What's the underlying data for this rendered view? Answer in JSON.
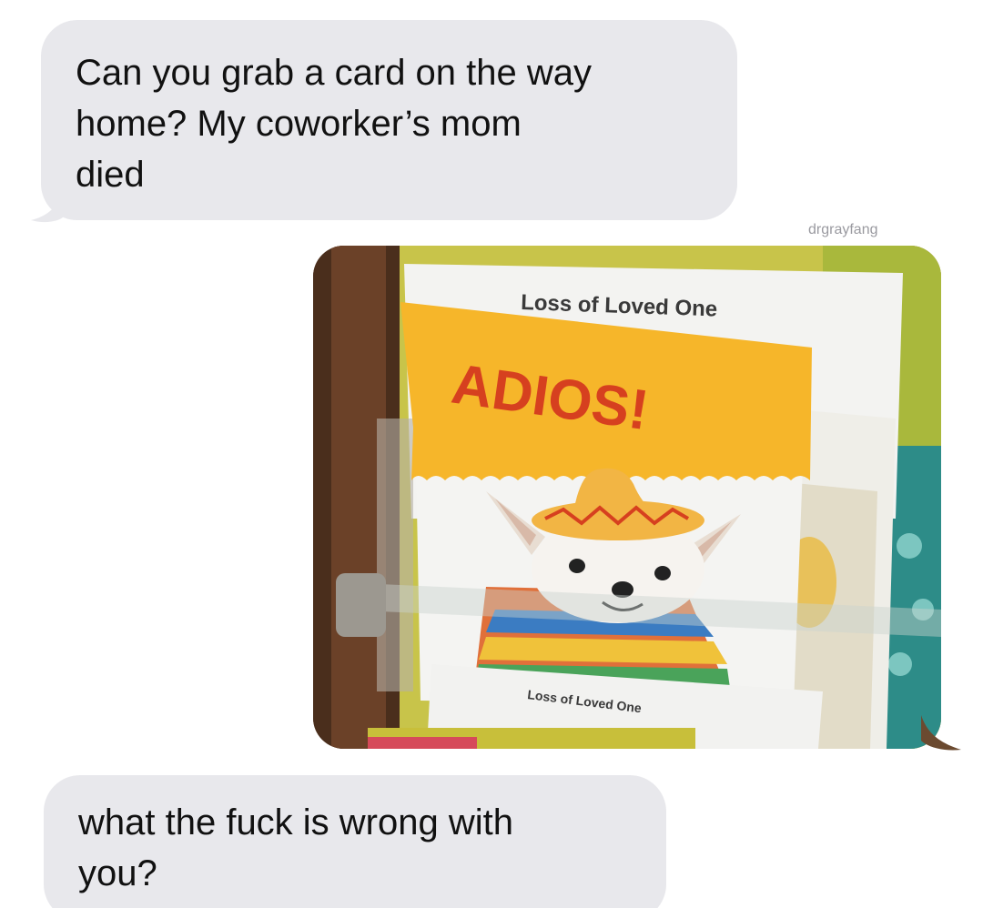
{
  "conversation": {
    "messages": [
      {
        "direction": "incoming",
        "text": "Can you grab a card on the way\nhome? My coworker’s mom\ndied"
      },
      {
        "direction": "outgoing",
        "type": "photo"
      },
      {
        "direction": "incoming",
        "text": "what the fuck is wrong with\nyou?"
      }
    ],
    "watermark": "drgrayfang"
  },
  "photo": {
    "back_card_label": "Loss of Loved One",
    "front_card_title": "ADIOS!",
    "front_card_bottom_label": "Loss of Loved One"
  },
  "colors": {
    "incoming_bubble": "#e8e8ec",
    "card_orange": "#f6b62a",
    "title_red": "#d6401f"
  }
}
